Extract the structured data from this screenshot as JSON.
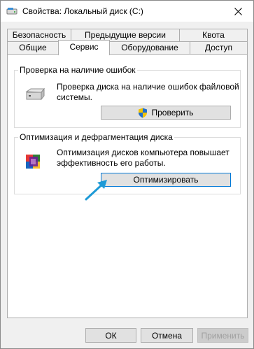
{
  "window": {
    "title": "Свойства: Локальный диск (C:)",
    "icon": "drive-icon",
    "close_icon": "close-icon"
  },
  "tabs": {
    "row_back": [
      {
        "label": "Безопасность"
      },
      {
        "label": "Предыдущие версии"
      },
      {
        "label": "Квота"
      }
    ],
    "row_front": [
      {
        "label": "Общие"
      },
      {
        "label": "Сервис",
        "active": true
      },
      {
        "label": "Оборудование"
      },
      {
        "label": "Доступ"
      }
    ]
  },
  "error_check": {
    "title": "Проверка на наличие ошибок",
    "description": "Проверка диска на наличие ошибок файловой системы.",
    "icon": "hard-drive-icon",
    "button_label": "Проверить",
    "button_icon": "uac-shield-icon"
  },
  "optimize": {
    "title": "Оптимизация и дефрагментация диска",
    "description": "Оптимизация дисков компьютера повышает эффективность его работы.",
    "icon": "defrag-icon",
    "button_label": "Оптимизировать"
  },
  "footer": {
    "ok_label": "ОК",
    "cancel_label": "Отмена",
    "apply_label": "Применить"
  },
  "colors": {
    "window_bg": "#f0f0f0",
    "panel_bg": "#ffffff",
    "accent": "#0078d7",
    "arrow": "#1e9ad6"
  }
}
